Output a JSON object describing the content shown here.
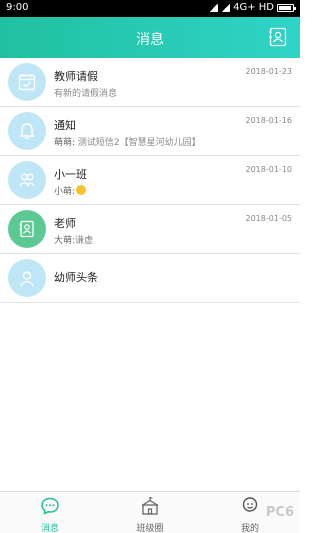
{
  "status_bar": {
    "time": "9:00",
    "network": "4G+ HD"
  },
  "header": {
    "title": "消息"
  },
  "messages": [
    {
      "title": "教师请假",
      "sender": "",
      "preview": "有新的请假消息",
      "date": "2018-01-23",
      "icon": "calendar-check-icon"
    },
    {
      "title": "通知",
      "sender": "萌萌:",
      "preview": " 测试短信2【智慧星河幼儿园】",
      "date": "2018-01-16",
      "icon": "bell-icon"
    },
    {
      "title": "小一班",
      "sender": "小萌:",
      "preview": "",
      "date": "2018-01-10",
      "icon": "group-icon"
    },
    {
      "title": "老师",
      "sender": "大萌:",
      "preview": "谦虚",
      "date": "2018-01-05",
      "icon": "contact-card-icon"
    },
    {
      "title": "幼师头条",
      "sender": "",
      "preview": "",
      "date": "",
      "icon": "teacher-avatar-icon"
    }
  ],
  "tabs": [
    {
      "label": "消息",
      "active": true,
      "icon": "chat-bubble-icon"
    },
    {
      "label": "班级圈",
      "active": false,
      "icon": "school-icon"
    },
    {
      "label": "我的",
      "active": false,
      "icon": "user-icon"
    }
  ],
  "watermark": "PC6",
  "colors": {
    "accent": "#21bfa0",
    "avatar_bg": "#bfe6f6",
    "avatar_green": "#5cc995"
  }
}
